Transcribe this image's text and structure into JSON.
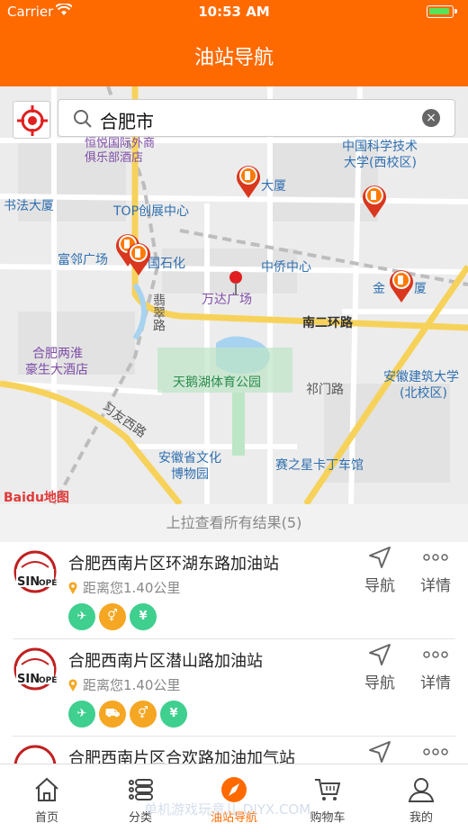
{
  "status_bar": {
    "carrier": "Carrier",
    "time": "10:53 AM"
  },
  "header": {
    "title": "油站导航"
  },
  "search": {
    "value": "合肥市"
  },
  "map": {
    "labels": {
      "hengyue": "恒悦国际俱乐部酒店",
      "hengyue_line1": "恒悦国际外商",
      "hengyue_line2": "俱乐部酒店",
      "shufa": "书法大厦",
      "top": "TOP创展中心",
      "fuyu": "富邻广场",
      "zhongguo_shihua": "中国石化",
      "zhongqiao": "中侨中心",
      "wanda": "万达广场",
      "cuiwei": "翡翠路",
      "nanerhuan": "南二环路",
      "hefei_liang_1": "合肥两淮",
      "hefei_liang_2": "豪生大酒店",
      "tiane": "天鹅湖体育公园",
      "ximen": "祁门路",
      "xiyou": "习友西路",
      "anhui_museum_1": "安徽省文化",
      "anhui_museum_2": "博物园",
      "saizhixing": "赛之星卡丁车馆",
      "ustc_1": "中国科学技术",
      "ustc_2": "大学(西校区)",
      "anhui_jz_1": "安徽建筑大学",
      "anhui_jz_2": "(北校区)",
      "jinyu": "金",
      "jinyu_2": "厦",
      "dasha": "大厦",
      "baidu": "Baidu地图"
    }
  },
  "pull_hint": "上拉查看所有结果(5)",
  "stations": [
    {
      "name": "合肥西南片区环湖东路加油站",
      "distance": "距离您1.40公里",
      "tags": [
        "wash-icon",
        "toilet-icon",
        "pay-icon"
      ],
      "nav_label": "导航",
      "detail_label": "详情"
    },
    {
      "name": "合肥西南片区潜山路加油站",
      "distance": "距离您1.40公里",
      "tags": [
        "wash-icon",
        "car-service-icon",
        "toilet-icon",
        "pay-icon"
      ],
      "nav_label": "导航",
      "detail_label": "详情"
    },
    {
      "name": "合肥西南片区合欢路加油加气站",
      "distance": "",
      "tags": [],
      "nav_label": "",
      "detail_label": ""
    }
  ],
  "tabbar": {
    "items": [
      {
        "label": "首页",
        "icon": "home-icon"
      },
      {
        "label": "分类",
        "icon": "list-icon"
      },
      {
        "label": "油站导航",
        "icon": "compass-icon"
      },
      {
        "label": "购物车",
        "icon": "cart-icon"
      },
      {
        "label": "我的",
        "icon": "user-icon"
      }
    ],
    "active_index": 2
  },
  "watermark": "单机游戏玩意儿 DJYX.COM",
  "colors": {
    "brand": "#ff6a00",
    "green_tag": "#3fcf8e",
    "orange_tag": "#f5a623"
  }
}
